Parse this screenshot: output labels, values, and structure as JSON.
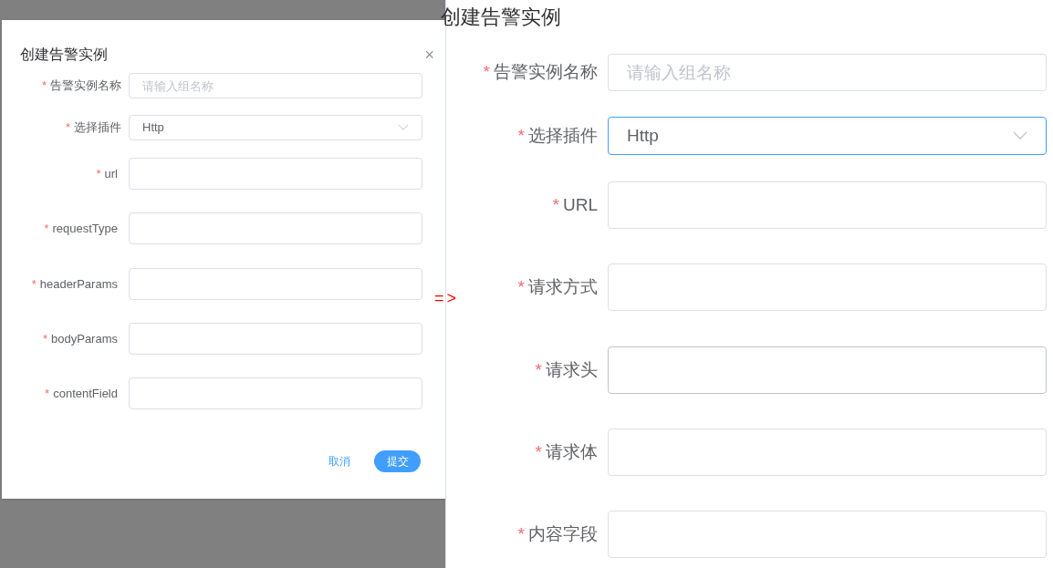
{
  "dialog": {
    "title": "创建告警实例",
    "close": "×",
    "fields": [
      {
        "label": "告警实例名称",
        "required_mark": "*",
        "kind": "input",
        "placeholder": "请输入组名称",
        "focused": false,
        "hovered": false
      },
      {
        "label": "选择插件",
        "required_mark": "*",
        "kind": "select",
        "value": "Http",
        "focused": false,
        "hovered": false
      },
      {
        "label": "url",
        "required_mark": "*",
        "kind": "input",
        "focused": false,
        "hovered": false
      },
      {
        "label": "requestType",
        "required_mark": "*",
        "kind": "input",
        "focused": false,
        "hovered": false
      },
      {
        "label": "headerParams",
        "required_mark": "*",
        "kind": "input",
        "focused": false,
        "hovered": false
      },
      {
        "label": "bodyParams",
        "required_mark": "*",
        "kind": "input",
        "focused": false,
        "hovered": false
      },
      {
        "label": "contentField",
        "required_mark": "*",
        "kind": "input",
        "focused": false,
        "hovered": false
      }
    ],
    "cancel": "取消",
    "submit": "提交"
  },
  "arrow": "=>",
  "preview": {
    "title": "创建告警实例",
    "fields": [
      {
        "label": "告警实例名称",
        "required_mark": "*",
        "kind": "input",
        "placeholder": "请输入组名称",
        "focused": false,
        "hovered": false
      },
      {
        "label": "选择插件",
        "required_mark": "*",
        "kind": "select",
        "value": "Http",
        "focused": true,
        "hovered": false
      },
      {
        "label": "URL",
        "required_mark": "*",
        "kind": "input",
        "focused": false,
        "hovered": false
      },
      {
        "label": "请求方式",
        "required_mark": "*",
        "kind": "input",
        "focused": false,
        "hovered": false
      },
      {
        "label": "请求头",
        "required_mark": "*",
        "kind": "input",
        "focused": false,
        "hovered": true
      },
      {
        "label": "请求体",
        "required_mark": "*",
        "kind": "input",
        "focused": false,
        "hovered": false
      },
      {
        "label": "内容字段",
        "required_mark": "*",
        "kind": "input",
        "focused": false,
        "hovered": false
      }
    ]
  }
}
